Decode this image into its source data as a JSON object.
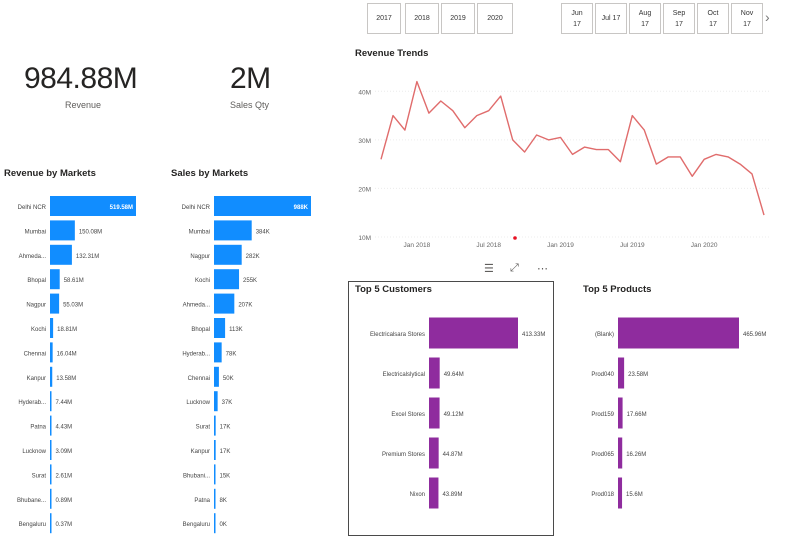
{
  "year_slicer": [
    "2017",
    "2018",
    "2019",
    "2020"
  ],
  "month_slicer": [
    {
      "month": "Jun",
      "year": "17"
    },
    {
      "month": "Jul 17",
      "year": ""
    },
    {
      "month": "Aug",
      "year": "17"
    },
    {
      "month": "Sep",
      "year": "17"
    },
    {
      "month": "Oct",
      "year": "17"
    },
    {
      "month": "Nov",
      "year": "17"
    }
  ],
  "icons": {
    "next": "chevron-right-icon",
    "filter": "filter-icon",
    "focus": "focus-mode-icon",
    "more": "more-options-icon"
  },
  "kpis": {
    "revenue": {
      "value": "984.88M",
      "label": "Revenue"
    },
    "sales_qty": {
      "value": "2M",
      "label": "Sales Qty"
    }
  },
  "colors": {
    "bar_blue": "#118dff",
    "bar_purple": "#8f2c9e",
    "line_red": "#e06c6c",
    "text_dark": "#252423"
  },
  "chart_data": [
    {
      "type": "bar",
      "orientation": "horizontal",
      "title": "Revenue by Markets",
      "categories": [
        "Delhi NCR",
        "Mumbai",
        "Ahmeda...",
        "Bhopal",
        "Nagpur",
        "Kochi",
        "Chennai",
        "Kanpur",
        "Hyderab...",
        "Patna",
        "Lucknow",
        "Surat",
        "Bhubane...",
        "Bengaluru"
      ],
      "values": [
        519.58,
        150.08,
        132.31,
        58.61,
        55.03,
        18.81,
        16.04,
        13.58,
        7.44,
        4.43,
        3.09,
        2.61,
        0.89,
        0.37
      ],
      "labels": [
        "519.58M",
        "150.08M",
        "132.31M",
        "58.61M",
        "55.03M",
        "18.81M",
        "16.04M",
        "13.58M",
        "7.44M",
        "4.43M",
        "3.09M",
        "2.61M",
        "0.89M",
        "0.37M"
      ],
      "xlim": [
        0,
        519.58
      ]
    },
    {
      "type": "bar",
      "orientation": "horizontal",
      "title": "Sales by Markets",
      "categories": [
        "Delhi NCR",
        "Mumbai",
        "Nagpur",
        "Kochi",
        "Ahmeda...",
        "Bhopal",
        "Hyderab...",
        "Chennai",
        "Lucknow",
        "Surat",
        "Kanpur",
        "Bhubani...",
        "Patna",
        "Bengaluru"
      ],
      "values": [
        988,
        384,
        282,
        255,
        207,
        113,
        78,
        50,
        37,
        17,
        17,
        15,
        8,
        0
      ],
      "labels": [
        "988K",
        "384K",
        "282K",
        "255K",
        "207K",
        "113K",
        "78K",
        "50K",
        "37K",
        "17K",
        "17K",
        "15K",
        "8K",
        "0K"
      ],
      "xlim": [
        0,
        988
      ]
    },
    {
      "type": "line",
      "title": "Revenue Trends",
      "x": [
        "2017-10",
        "2017-11",
        "2017-12",
        "2018-01",
        "2018-02",
        "2018-03",
        "2018-04",
        "2018-05",
        "2018-06",
        "2018-07",
        "2018-08",
        "2018-09",
        "2018-10",
        "2018-11",
        "2018-12",
        "2019-01",
        "2019-02",
        "2019-03",
        "2019-04",
        "2019-05",
        "2019-06",
        "2019-07",
        "2019-08",
        "2019-09",
        "2019-10",
        "2019-11",
        "2019-12",
        "2020-01",
        "2020-02",
        "2020-03",
        "2020-04",
        "2020-05",
        "2020-06"
      ],
      "values": [
        26,
        35,
        32,
        42,
        35.5,
        38,
        36,
        32.5,
        35,
        36,
        39,
        30,
        27.5,
        31,
        30,
        30.5,
        27,
        28.5,
        28,
        28,
        25.5,
        35,
        32,
        25,
        26.5,
        26.5,
        22.5,
        26,
        27,
        26.5,
        25,
        23,
        14.5
      ],
      "x_tick_labels": [
        "Jan 2018",
        "Jul 2018",
        "Jan 2019",
        "Jul 2019",
        "Jan 2020"
      ],
      "y_tick_labels": [
        "10M",
        "20M",
        "30M",
        "40M"
      ],
      "ylim": [
        10,
        45
      ],
      "color": "#e06c6c",
      "grid": true
    },
    {
      "type": "bar",
      "orientation": "horizontal",
      "title": "Top 5 Customers",
      "categories": [
        "Electricalsara Stores",
        "Electricalslytical",
        "Excel Stores",
        "Premium Stores",
        "Nixon"
      ],
      "values": [
        413.33,
        49.64,
        49.12,
        44.87,
        43.89
      ],
      "labels": [
        "413.33M",
        "49.64M",
        "49.12M",
        "44.87M",
        "43.89M"
      ],
      "xlim": [
        0,
        413.33
      ]
    },
    {
      "type": "bar",
      "orientation": "horizontal",
      "title": "Top 5 Products",
      "categories": [
        "(Blank)",
        "Prod040",
        "Prod159",
        "Prod065",
        "Prod018"
      ],
      "values": [
        465.96,
        23.58,
        17.66,
        16.26,
        15.6
      ],
      "labels": [
        "465.96M",
        "23.58M",
        "17.66M",
        "16.26M",
        "15.6M"
      ],
      "xlim": [
        0,
        465.96
      ]
    }
  ]
}
